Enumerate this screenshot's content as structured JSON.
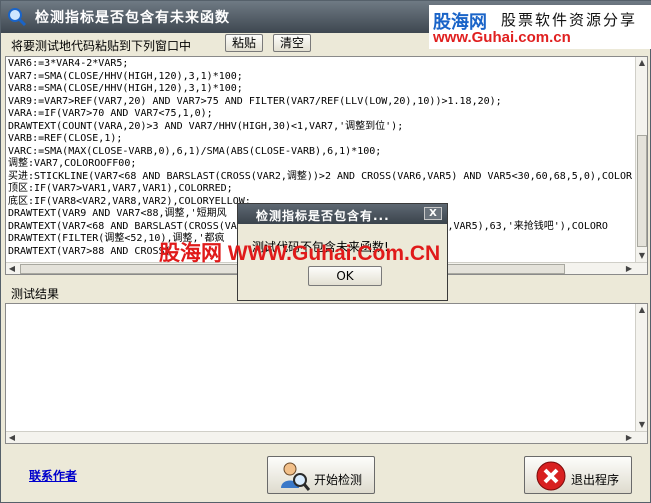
{
  "window": {
    "title": "检测指标是否包含有未来函数"
  },
  "brand": {
    "name": "股海网",
    "slogan": "股票软件资源分享",
    "url": "www.Guhai.com.cn"
  },
  "instruction": "将要测试地代码粘贴到下列窗口中",
  "toolbar": {
    "paste_label": "粘贴",
    "clear_label": "清空"
  },
  "code_lines": [
    "VAR6:=3*VAR4-2*VAR5;",
    "VAR7:=SMA(CLOSE/HHV(HIGH,120),3,1)*100;",
    "VAR8:=SMA(CLOSE/HHV(HIGH,120),3,1)*100;",
    "VAR9:=VAR7>REF(VAR7,20) AND VAR7>75 AND FILTER(VAR7/REF(LLV(LOW,20),10))>1.18,20);",
    "VARA:=IF(VAR7>70 AND VAR7<75,1,0);",
    "DRAWTEXT(COUNT(VARA,20)>3 AND VAR7/HHV(HIGH,30)<1,VAR7,'调整到位');",
    "VARB:=REF(CLOSE,1);",
    "VARC:=SMA(MAX(CLOSE-VARB,0),6,1)/SMA(ABS(CLOSE-VARB),6,1)*100;",
    "调整:VAR7,COLOROOFF00;",
    "买进:STICKLINE(VAR7<68 AND BARSLAST(CROSS(VAR2,调整))>2 AND CROSS(VAR6,VAR5) AND VAR5<30,60,68,5,0),COLOR",
    "顶区:IF(VAR7>VAR1,VAR7,VAR1),COLORRED;",
    "底区:IF(VAR8<VAR2,VAR8,VAR2),COLORYELLOW;",
    "DRAWTEXT(VAR9 AND VAR7<88,调整,'短期风",
    "DRAWTEXT(VAR7<68 AND BARSLAST(CROSS(VA                                  6,VAR5),63,'来抢钱吧'),COLORO",
    "DRAWTEXT(FILTER(调整<52,10),调整,'都疯",
    "DRAWTEXT(VAR7>88 AND CROSS("
  ],
  "results": {
    "label": "测试结果"
  },
  "footer": {
    "contact_label": "联系作者",
    "start_label": "开始检测",
    "exit_label": "退出程序"
  },
  "dialog": {
    "title": "检测指标是否包含有...",
    "close_glyph": "X",
    "message": "测试代码不包含未来函数!",
    "ok_label": "OK"
  },
  "watermark": {
    "cn": "股海网",
    "url": "WWW.Guhai.Com.CN"
  },
  "icons": {
    "app": "magnifier-icon",
    "start": "search-person-icon",
    "exit": "red-x-icon",
    "close": "close-icon"
  }
}
